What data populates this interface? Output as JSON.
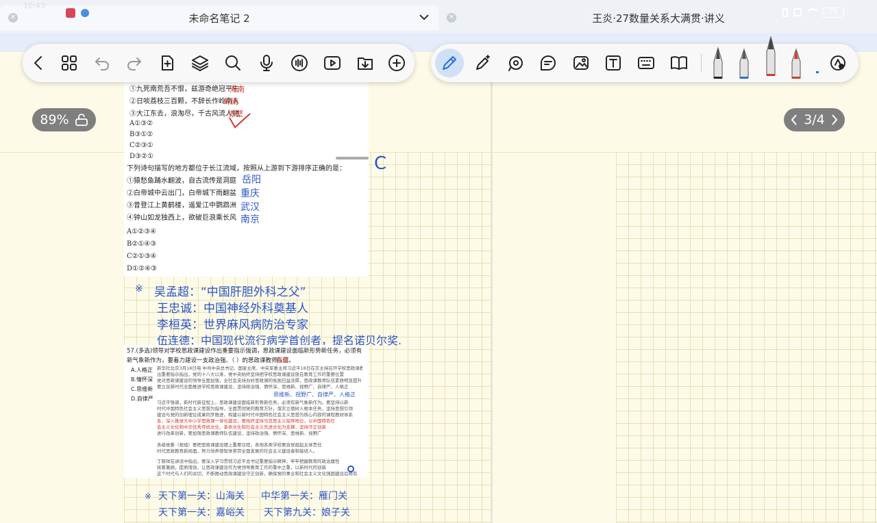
{
  "tabs": {
    "left": {
      "title": "未命名笔记 2",
      "dropdown_icon": "chevron-down-icon"
    },
    "right": {
      "title": "王炎·27数量关系大满贯·讲义"
    }
  },
  "status": {
    "time": "10:43",
    "battery": "75"
  },
  "left_toolbar": {
    "icons": [
      "back-icon",
      "grid-icon",
      "undo-icon",
      "redo-icon",
      "add-page-icon",
      "layers-icon",
      "search-icon",
      "microphone-icon",
      "audio-wave-icon",
      "play-video-icon",
      "import-icon",
      "add-icon"
    ]
  },
  "right_toolbar": {
    "icons": [
      "pen-icon",
      "magic-pen-icon",
      "lasso-icon",
      "sticker-icon",
      "image-icon",
      "text-icon",
      "keyboard-icon",
      "book-icon",
      "more-tools-icon"
    ],
    "pen_colors": [
      "#222222",
      "#2b6fd6",
      "#d23b2b",
      "#d23b2b",
      "#2b6fd6"
    ]
  },
  "zoom": {
    "label": "89%"
  },
  "pager": {
    "label": "3/4"
  },
  "clip1": {
    "lines": [
      "①九死南荒吾不恨，兹游奇绝冠平生",
      "②日啖荔枝三百颗，不辞长作岭南人",
      "③大江东去，浪淘尽，千古风流人物"
    ],
    "options": [
      "A①③②",
      "B③①②",
      "C②③①",
      "D③②①"
    ],
    "notes": [
      "海南",
      "岭南",
      "赤壁"
    ]
  },
  "clip2": {
    "question": "下列诗句描写的地方都位于长江流域，按照从上游到下游排序正确的是：",
    "lines": [
      "①猿愁鱼踊水翻波，自古流传是洞庭",
      "②白帝城中云出门，白帝城下雨翻盆",
      "③昔登江上黄鹤楼，遥爱江中鹦鹉洲",
      "④钟山如龙独西上，欲破巨浪乘长风"
    ],
    "options": [
      "A①②③④",
      "B②①④③",
      "C②①③④",
      "D①②④③"
    ],
    "notes": [
      "岳阳",
      "重庆",
      "武汉",
      "南京"
    ],
    "answer_mark": "C"
  },
  "handwritten1": {
    "star": "※",
    "lines": [
      "吴孟超：“中国肝胆外科之父”",
      "王忠诚：中国神经外科奠基人",
      "李桓英：世界麻风病防治专家",
      "伍连德：中国现代流行病学首创者，提名诺贝尔奖."
    ]
  },
  "clip3": {
    "question": "57.(多选)领导对学校思政课建设作出重要指示强调，思政课建设面临新形势新任务，必须有新气象新作为，要着力建设一支政治强、（    ）的思政课教师队伍。",
    "options": [
      "A.人格正",
      "B.情怀深",
      "C.思维新",
      "D.自律严"
    ],
    "note": "自律",
    "keywords": "思维新、视野广、自律严、人格正",
    "text_lines": [
      "新华社北京3月18日电 中共中央总书记、国家主席、中央军委主席习近平18日在京主持召开学校思政课教师座谈会并发表重要讲话",
      "出重要指示指出，党的十八大以来，党中央始终坚持把学校思政课建设放在教育工作的重要位置",
      "党对思政课建设的领导全面加强，全社会支持办好思政课的氛围日益浓厚，思政课教师队伍素质明显提升",
      "要立足新时代全面推进学校思政课建设，坚持政治强、情怀深、思维新、视野广、自律严、人格正",
      "习近平强调，新时代新征程上，思政课建设面临新形势新任务，必须有新气象新作为。要坚持以新",
      "时代中国特色社会主义思想为指导，全面贯彻党的教育方针，落实立德树人根本任务，坚持思想引领",
      "建设与党的创新理论成果同步推进，构建以新时代中国特色社会主义思想为核心内容的课程教材体系",
      "系，深入推进大中小学思政课一体化建设，要始终坚持马克思主义指导地位，以中国特色社",
      "会主义文化和中华优秀传统文化、革命文化和社会主义先进文化为支撑，坚持守正创新",
      "进行改革创新，要加强思政课教师队伍建设，坚持政治强、情怀深、思维新、视野广",
      "各级党委（党组）要把思政课建设摆上重要议程，各地各类学校要自觉担起主体责任",
      "时代思政教育新局面，努力培养德智体美劳全面发展的社会主义建设者和接班人。",
      "丁薛祥在讲话中指出，要深入学习贯彻习近平总书记重要指示精神，牢牢把握教育的政治属性",
      "统筹兼顾，提质增效，让思政课建设作为党领导教育工作的重中之重，以新时代的创新",
      "这个时代与人们的关切，不断推动思政课建设守正创新，确保党的事业和社会主义文化强国建设后继有"
    ]
  },
  "handwritten2": {
    "star": "※",
    "col1": [
      "天下第一关：山海关",
      "天下第一关：嘉峪关"
    ],
    "col2": [
      "中华第一关：雁门关",
      "天下第九关：娘子关"
    ]
  }
}
